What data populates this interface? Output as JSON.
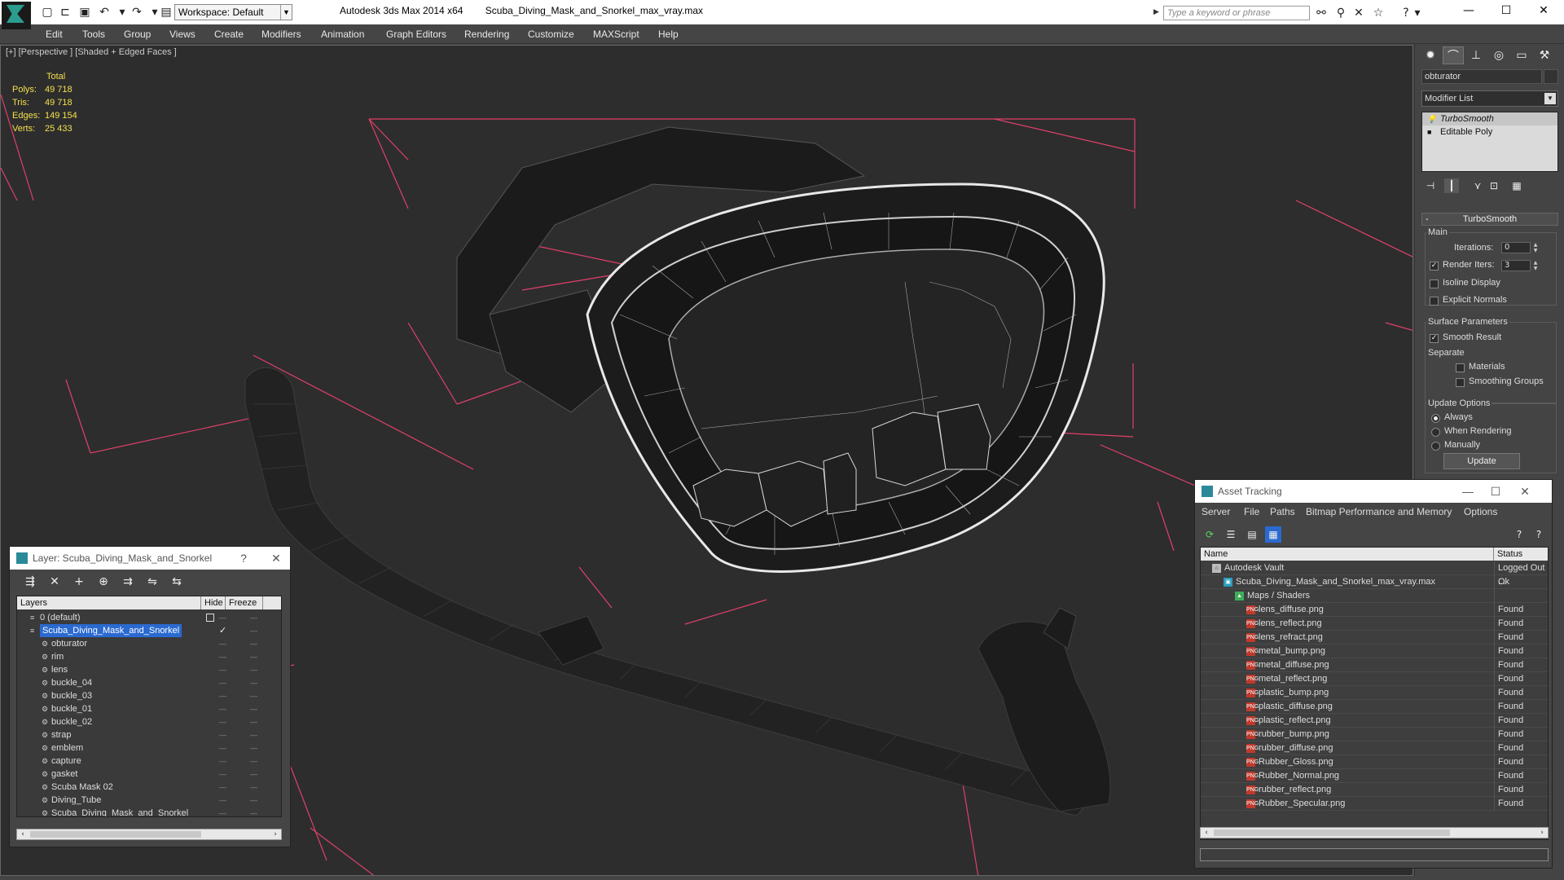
{
  "app": {
    "title": "Autodesk 3ds Max  2014 x64",
    "file": "Scuba_Diving_Mask_and_Snorkel_max_vray.max",
    "workspace": "Workspace: Default",
    "search_placeholder": "Type a keyword or phrase"
  },
  "menu": [
    "Edit",
    "Tools",
    "Group",
    "Views",
    "Create",
    "Modifiers",
    "Animation",
    "Graph Editors",
    "Rendering",
    "Customize",
    "MAXScript",
    "Help"
  ],
  "viewport": {
    "label": "[+] [Perspective ] [Shaded + Edged Faces ]",
    "stats": {
      "header": "Total",
      "rows": [
        {
          "k": "Polys:",
          "v": "49 718"
        },
        {
          "k": "Tris:",
          "v": "49 718"
        },
        {
          "k": "Edges:",
          "v": "149 154"
        },
        {
          "k": "Verts:",
          "v": "25 433"
        }
      ]
    }
  },
  "command_panel": {
    "object_name": "obturator",
    "modifier_list": "Modifier List",
    "stack": [
      "TurboSmooth",
      "Editable Poly"
    ],
    "rollout": "TurboSmooth",
    "main": "Main",
    "iterations_label": "Iterations:",
    "iterations": "0",
    "render_iters_label": "Render Iters:",
    "render_iters": "3",
    "isoline": "Isoline Display",
    "explicit_normals": "Explicit Normals",
    "surface_params": "Surface Parameters",
    "smooth_result": "Smooth Result",
    "separate": "Separate",
    "materials": "Materials",
    "smoothing_groups": "Smoothing Groups",
    "update_options": "Update Options",
    "always": "Always",
    "when_rendering": "When Rendering",
    "manually": "Manually",
    "update": "Update"
  },
  "layer_window": {
    "title": "Layer: Scuba_Diving_Mask_and_Snorkel",
    "help": "?",
    "columns": [
      "Layers",
      "Hide",
      "Freeze"
    ],
    "rows": [
      {
        "name": "0 (default)",
        "level": 0,
        "selected": false
      },
      {
        "name": "Scuba_Diving_Mask_and_Snorkel",
        "level": 0,
        "selected": true
      },
      {
        "name": "obturator",
        "level": 1,
        "selected": false
      },
      {
        "name": "rim",
        "level": 1,
        "selected": false
      },
      {
        "name": "lens",
        "level": 1,
        "selected": false
      },
      {
        "name": "buckle_04",
        "level": 1,
        "selected": false
      },
      {
        "name": "buckle_03",
        "level": 1,
        "selected": false
      },
      {
        "name": "buckle_01",
        "level": 1,
        "selected": false
      },
      {
        "name": "buckle_02",
        "level": 1,
        "selected": false
      },
      {
        "name": "strap",
        "level": 1,
        "selected": false
      },
      {
        "name": "emblem",
        "level": 1,
        "selected": false
      },
      {
        "name": "capture",
        "level": 1,
        "selected": false
      },
      {
        "name": "gasket",
        "level": 1,
        "selected": false
      },
      {
        "name": "Scuba Mask 02",
        "level": 1,
        "selected": false
      },
      {
        "name": "Diving_Tube",
        "level": 1,
        "selected": false
      },
      {
        "name": "Scuba_Diving_Mask_and_Snorkel",
        "level": 1,
        "selected": false
      }
    ]
  },
  "asset_window": {
    "title": "Asset Tracking",
    "menu": [
      "Server",
      "File",
      "Paths",
      "Bitmap Performance and Memory",
      "Options"
    ],
    "columns": [
      "Name",
      "Status"
    ],
    "rows": [
      {
        "name": "Autodesk Vault",
        "status": "Logged Out ...",
        "icon": "vault",
        "level": 1
      },
      {
        "name": "Scuba_Diving_Mask_and_Snorkel_max_vray.max",
        "status": "Ok",
        "icon": "max",
        "level": 2
      },
      {
        "name": "Maps / Shaders",
        "status": "",
        "icon": "map",
        "level": 3
      },
      {
        "name": "lens_diffuse.png",
        "status": "Found",
        "icon": "png",
        "level": 4
      },
      {
        "name": "lens_reflect.png",
        "status": "Found",
        "icon": "png",
        "level": 4
      },
      {
        "name": "lens_refract.png",
        "status": "Found",
        "icon": "png",
        "level": 4
      },
      {
        "name": "metal_bump.png",
        "status": "Found",
        "icon": "png",
        "level": 4
      },
      {
        "name": "metal_diffuse.png",
        "status": "Found",
        "icon": "png",
        "level": 4
      },
      {
        "name": "metal_reflect.png",
        "status": "Found",
        "icon": "png",
        "level": 4
      },
      {
        "name": "plastic_bump.png",
        "status": "Found",
        "icon": "png",
        "level": 4
      },
      {
        "name": "plastic_diffuse.png",
        "status": "Found",
        "icon": "png",
        "level": 4
      },
      {
        "name": "plastic_reflect.png",
        "status": "Found",
        "icon": "png",
        "level": 4
      },
      {
        "name": "rubber_bump.png",
        "status": "Found",
        "icon": "png",
        "level": 4
      },
      {
        "name": "rubber_diffuse.png",
        "status": "Found",
        "icon": "png",
        "level": 4
      },
      {
        "name": "Rubber_Gloss.png",
        "status": "Found",
        "icon": "png",
        "level": 4
      },
      {
        "name": "Rubber_Normal.png",
        "status": "Found",
        "icon": "png",
        "level": 4
      },
      {
        "name": "rubber_reflect.png",
        "status": "Found",
        "icon": "png",
        "level": 4
      },
      {
        "name": "Rubber_Specular.png",
        "status": "Found",
        "icon": "png",
        "level": 4
      }
    ]
  },
  "colors": {
    "viewport_bg": "#2d2d2d",
    "stats": "#f4e04d",
    "bbox": "#e0406a",
    "selection": "#2a6ad0"
  }
}
